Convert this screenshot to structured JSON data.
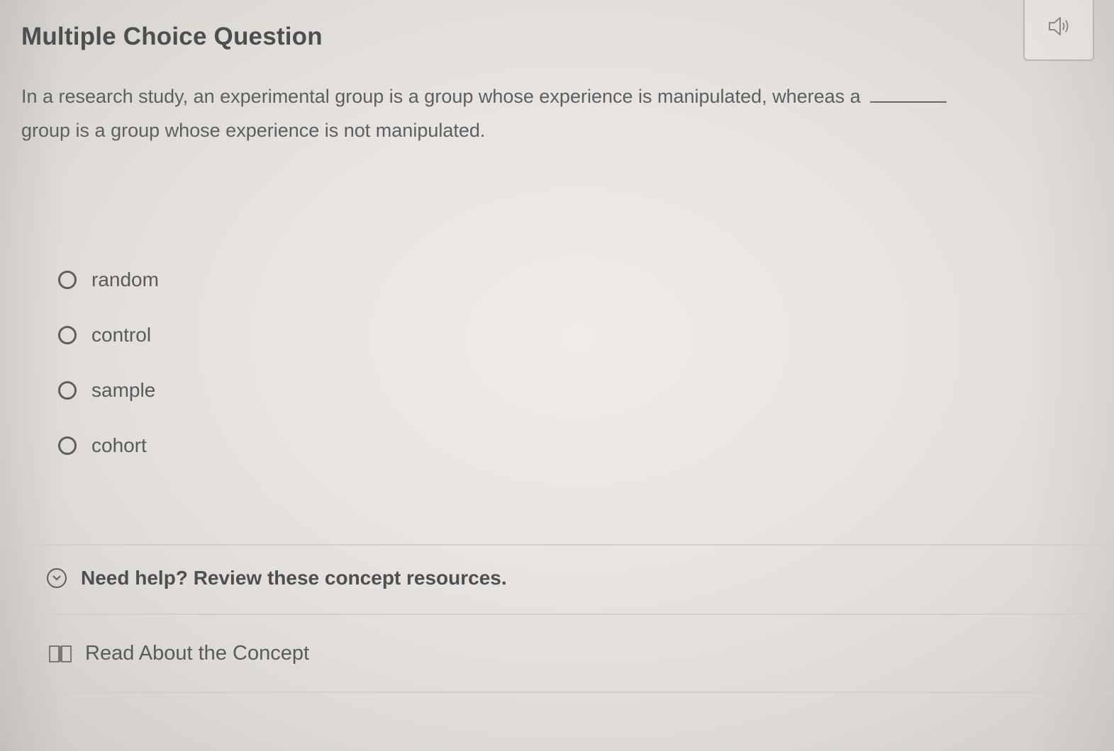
{
  "question": {
    "title": "Multiple Choice Question",
    "prompt_part1": "In a research study, an experimental group is a group whose experience is manipulated, whereas a",
    "prompt_part2": "group is a group whose experience is not manipulated."
  },
  "audio": {
    "icon": "speaker-icon"
  },
  "options": [
    {
      "label": "random",
      "selected": false
    },
    {
      "label": "control",
      "selected": false
    },
    {
      "label": "sample",
      "selected": false
    },
    {
      "label": "cohort",
      "selected": false
    }
  ],
  "help": {
    "label": "Need help? Review these concept resources.",
    "icon": "chevron-down-icon"
  },
  "resources": [
    {
      "label": "Read About the Concept",
      "icon": "book-icon"
    }
  ]
}
